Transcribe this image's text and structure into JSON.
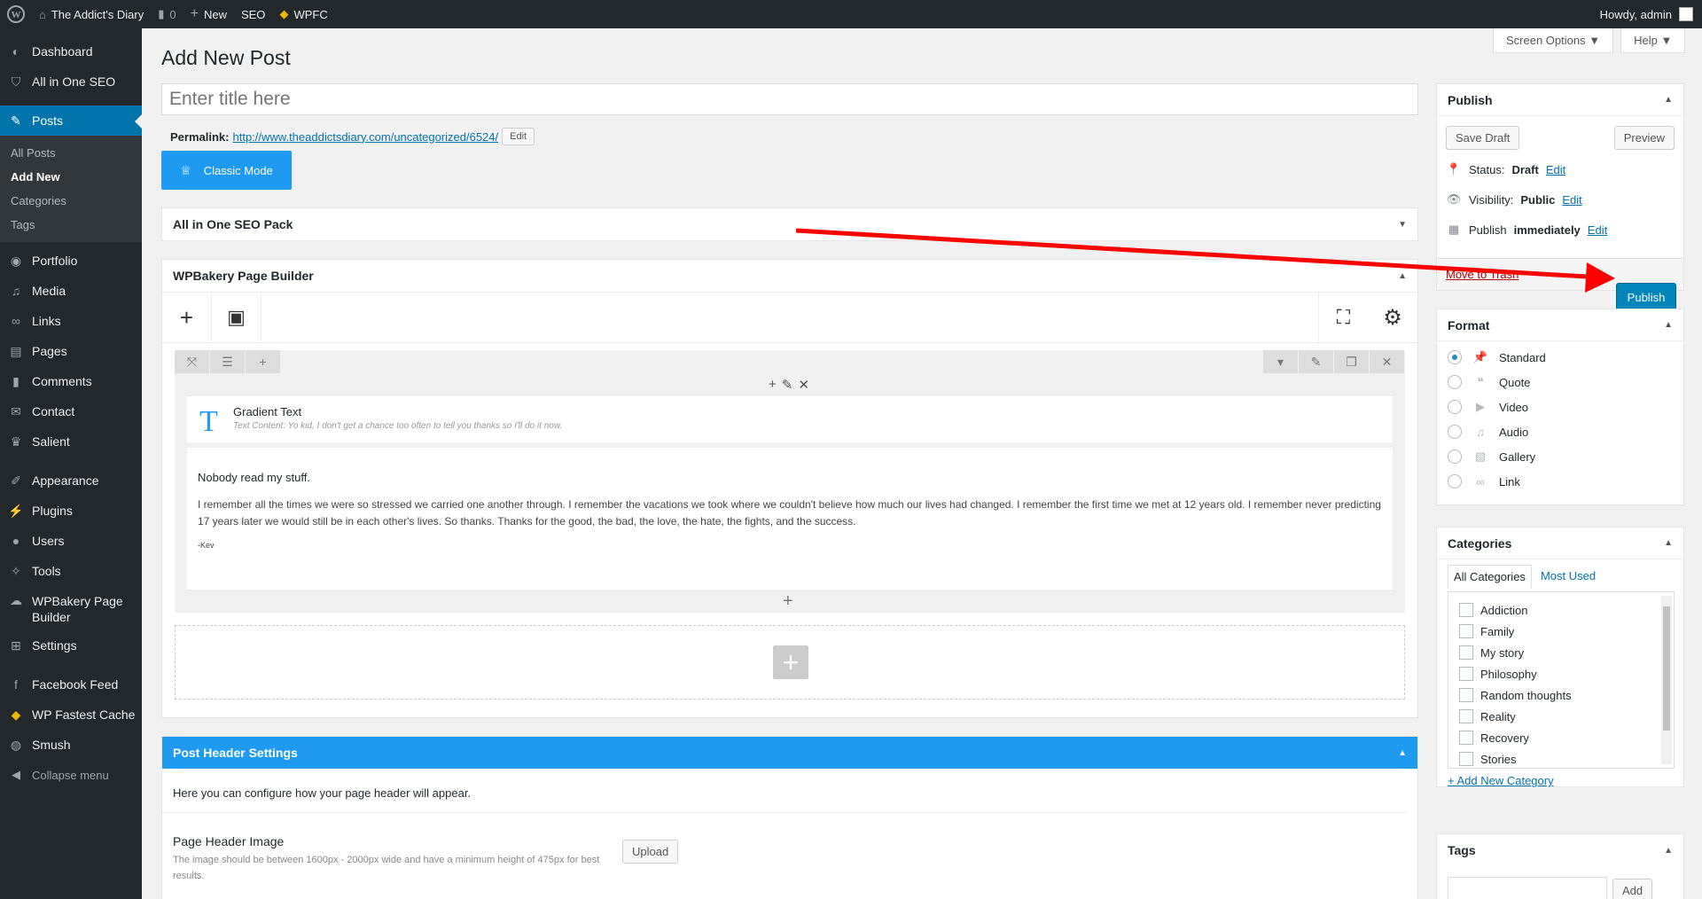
{
  "adminbar": {
    "site_name": "The Addict's Diary",
    "comments_count": "0",
    "new_label": "New",
    "seo_label": "SEO",
    "wpfc_label": "WPFC",
    "howdy": "Howdy, admin"
  },
  "sidebar": {
    "items": [
      {
        "label": "Dashboard",
        "icon": "dashboard-icon"
      },
      {
        "label": "All in One SEO",
        "icon": "shield-icon"
      },
      {
        "label": "Posts",
        "icon": "pin-icon"
      },
      {
        "label": "Portfolio",
        "icon": "portfolio-icon"
      },
      {
        "label": "Media",
        "icon": "media-icon"
      },
      {
        "label": "Links",
        "icon": "link-icon"
      },
      {
        "label": "Pages",
        "icon": "pages-icon"
      },
      {
        "label": "Comments",
        "icon": "comment-icon"
      },
      {
        "label": "Contact",
        "icon": "mail-icon"
      },
      {
        "label": "Salient",
        "icon": "salient-icon"
      },
      {
        "label": "Appearance",
        "icon": "brush-icon"
      },
      {
        "label": "Plugins",
        "icon": "plugin-icon"
      },
      {
        "label": "Users",
        "icon": "user-icon"
      },
      {
        "label": "Tools",
        "icon": "wrench-icon"
      },
      {
        "label": "WPBakery Page Builder",
        "icon": "wpbakery-icon"
      },
      {
        "label": "Settings",
        "icon": "settings-icon"
      },
      {
        "label": "Facebook Feed",
        "icon": "facebook-icon"
      },
      {
        "label": "WP Fastest Cache",
        "icon": "cheetah-icon"
      },
      {
        "label": "Smush",
        "icon": "smush-icon"
      },
      {
        "label": "Collapse menu",
        "icon": "collapse-icon"
      }
    ],
    "posts_sub": [
      "All Posts",
      "Add New",
      "Categories",
      "Tags"
    ]
  },
  "screen_options": {
    "label": "Screen Options ▼",
    "help": "Help ▼"
  },
  "main": {
    "page_title": "Add New Post",
    "title_placeholder": "Enter title here",
    "permalink_label": "Permalink:",
    "permalink_url": "http://www.theaddictsdiary.com/uncategorized/6524/",
    "permalink_edit": "Edit",
    "classic_mode": "Classic Mode",
    "seo_box_title": "All in One SEO Pack",
    "wpbakery_title": "WPBakery Page Builder",
    "gradient_title": "Gradient Text",
    "gradient_content": "Text Content: Yo kid, I don't get a chance too often to tell you thanks so I'll do it now.",
    "text_heading": "Nobody read my stuff.",
    "text_body": "I remember all the times we were so stressed we carried one another through. I remember the vacations we took where we couldn't believe how much our lives had changed. I remember the first time we met at 12 years old. I remember never predicting 17 years later we would still be in each other's lives. So thanks. Thanks for the good, the bad, the love, the hate, the fights, and the success.",
    "text_sign": "-Kev",
    "post_header_title": "Post Header Settings",
    "post_header_desc": "Here you can configure how your page header will appear.",
    "header_image_label": "Page Header Image",
    "header_image_desc": "The image should be between 1600px - 2000px wide and have a minimum height of 475px for best results.",
    "upload_label": "Upload"
  },
  "publish": {
    "title": "Publish",
    "save_draft": "Save Draft",
    "preview": "Preview",
    "status_label": "Status:",
    "status_value": "Draft",
    "visibility_label": "Visibility:",
    "visibility_value": "Public",
    "schedule_label": "Publish",
    "schedule_value": "immediately",
    "edit": "Edit",
    "trash": "Move to Trash",
    "publish_btn": "Publish"
  },
  "format": {
    "title": "Format",
    "options": [
      "Standard",
      "Quote",
      "Video",
      "Audio",
      "Gallery",
      "Link"
    ],
    "selected": "Standard"
  },
  "categories": {
    "title": "Categories",
    "tab_all": "All Categories",
    "tab_used": "Most Used",
    "items": [
      "Addiction",
      "Family",
      "My story",
      "Philosophy",
      "Random thoughts",
      "Reality",
      "Recovery",
      "Stories"
    ],
    "add_new": "+ Add New Category"
  },
  "tags": {
    "title": "Tags",
    "add": "Add"
  },
  "colors": {
    "accent": "#1e9bf0",
    "wp_blue": "#0073aa",
    "annotation": "#ff0000"
  }
}
